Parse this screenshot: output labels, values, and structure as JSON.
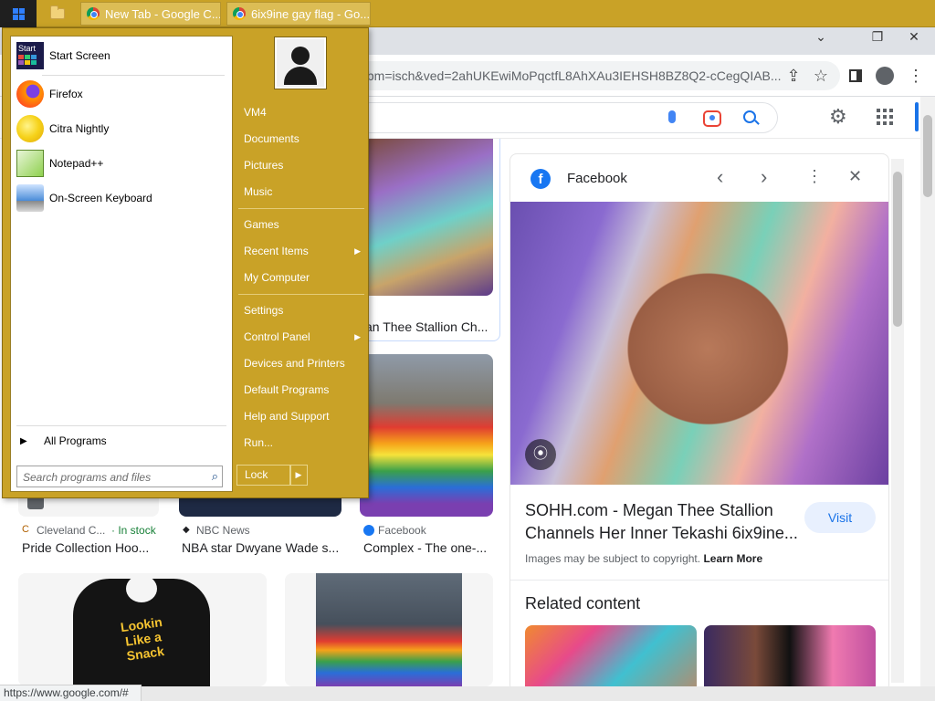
{
  "taskbar": {
    "tabs": [
      {
        "label": "New Tab - Google C..."
      },
      {
        "label": "6ix9ine gay flag - Go..."
      }
    ]
  },
  "browser": {
    "url": "tbm=isch&ved=2ahUKEwiMoPqctfL8AhXAu3IEHSH8BZ8Q2-cCegQIAB...",
    "status_url": "https://www.google.com/#"
  },
  "results": {
    "top_caption": "an Thee Stallion Ch...",
    "row1": [
      {
        "source": "Cleveland C...",
        "stock": "In stock",
        "title": "Pride Collection Hoo..."
      },
      {
        "source": "NBC News",
        "title": "NBA star Dwyane Wade s..."
      },
      {
        "source": "Facebook",
        "title": "Complex - The one-..."
      }
    ],
    "hoodie_text": "Lookin Like a Snack"
  },
  "panel": {
    "source": "Facebook",
    "title_line1": "SOHH.com - Megan Thee Stallion",
    "title_line2": "Channels Her Inner Tekashi 6ix9ine...",
    "visit_label": "Visit",
    "copyright": "Images may be subject to copyright.",
    "learn_more": "Learn More",
    "related_heading": "Related content"
  },
  "start_menu": {
    "pinned": [
      {
        "label": "Start Screen",
        "tile_text": "Start"
      },
      {
        "label": "Firefox"
      },
      {
        "label": "Citra Nightly"
      },
      {
        "label": "Notepad++"
      },
      {
        "label": "On-Screen Keyboard"
      }
    ],
    "all_programs": "All Programs",
    "search_placeholder": "Search programs and files",
    "right_items": [
      {
        "label": "VM4"
      },
      {
        "label": "Documents"
      },
      {
        "label": "Pictures"
      },
      {
        "label": "Music"
      },
      {
        "label": "Games"
      },
      {
        "label": "Recent Items"
      },
      {
        "label": "My Computer"
      },
      {
        "label": "Settings"
      },
      {
        "label": "Control Panel"
      },
      {
        "label": "Devices and Printers"
      },
      {
        "label": "Default Programs"
      },
      {
        "label": "Help and Support"
      },
      {
        "label": "Run..."
      }
    ],
    "lock_label": "Lock"
  },
  "colors": {
    "taskbar": "#c9a227",
    "accent": "#1a73e8",
    "facebook": "#1877f2"
  }
}
